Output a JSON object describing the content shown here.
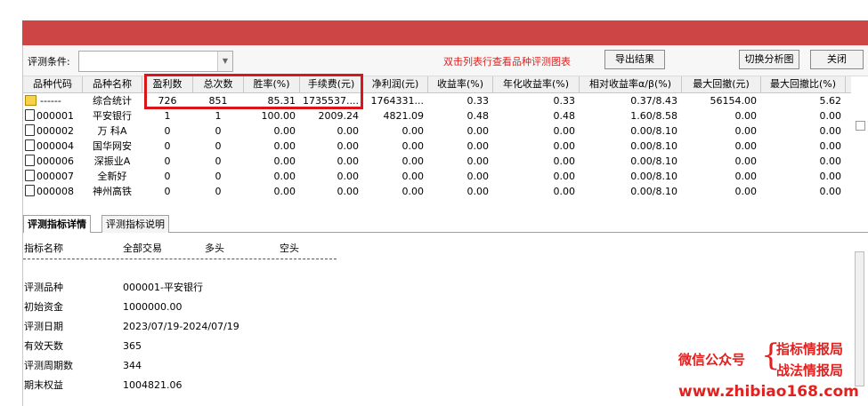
{
  "toolbar": {
    "condition_label": "评测条件:",
    "condition_value": "",
    "hint": "双击列表行查看品种评测图表",
    "export_label": "导出结果",
    "switch_label": "切换分析图",
    "close_label": "关闭"
  },
  "table": {
    "columns": [
      "品种代码",
      "品种名称",
      "盈利数",
      "总次数",
      "胜率(%)",
      "手续费(元)",
      "净利润(元)",
      "收益率(%)",
      "年化收益率(%)",
      "相对收益率α/β(%)",
      "最大回撤(元)",
      "最大回撤比(%)"
    ],
    "rows": [
      {
        "code": "------",
        "name": "综合统计",
        "wins": "726",
        "total": "851",
        "winrate": "85.31",
        "fee": "1735537....",
        "profit": "1764331...",
        "ret": "0.33",
        "annual": "0.33",
        "rel": "0.37/8.43",
        "maxdd": "56154.00",
        "maxddpct": "5.62"
      },
      {
        "code": "000001",
        "name": "平安银行",
        "wins": "1",
        "total": "1",
        "winrate": "100.00",
        "fee": "2009.24",
        "profit": "4821.09",
        "ret": "0.48",
        "annual": "0.48",
        "rel": "1.60/8.58",
        "maxdd": "0.00",
        "maxddpct": "0.00"
      },
      {
        "code": "000002",
        "name": "万 科A",
        "wins": "0",
        "total": "0",
        "winrate": "0.00",
        "fee": "0.00",
        "profit": "0.00",
        "ret": "0.00",
        "annual": "0.00",
        "rel": "0.00/8.10",
        "maxdd": "0.00",
        "maxddpct": "0.00"
      },
      {
        "code": "000004",
        "name": "国华网安",
        "wins": "0",
        "total": "0",
        "winrate": "0.00",
        "fee": "0.00",
        "profit": "0.00",
        "ret": "0.00",
        "annual": "0.00",
        "rel": "0.00/8.10",
        "maxdd": "0.00",
        "maxddpct": "0.00"
      },
      {
        "code": "000006",
        "name": "深振业A",
        "wins": "0",
        "total": "0",
        "winrate": "0.00",
        "fee": "0.00",
        "profit": "0.00",
        "ret": "0.00",
        "annual": "0.00",
        "rel": "0.00/8.10",
        "maxdd": "0.00",
        "maxddpct": "0.00"
      },
      {
        "code": "000007",
        "name": "全新好",
        "wins": "0",
        "total": "0",
        "winrate": "0.00",
        "fee": "0.00",
        "profit": "0.00",
        "ret": "0.00",
        "annual": "0.00",
        "rel": "0.00/8.10",
        "maxdd": "0.00",
        "maxddpct": "0.00"
      },
      {
        "code": "000008",
        "name": "神州高铁",
        "wins": "0",
        "total": "0",
        "winrate": "0.00",
        "fee": "0.00",
        "profit": "0.00",
        "ret": "0.00",
        "annual": "0.00",
        "rel": "0.00/8.10",
        "maxdd": "0.00",
        "maxddpct": "0.00"
      }
    ]
  },
  "tabs": [
    "评测指标详情",
    "评测指标说明"
  ],
  "detail": {
    "header": [
      "指标名称",
      "全部交易",
      "多头",
      "空头"
    ],
    "items": [
      {
        "key": "评测品种",
        "value": "000001-平安银行"
      },
      {
        "key": "初始资金",
        "value": "1000000.00"
      },
      {
        "key": "评测日期",
        "value": "2023/07/19-2024/07/19"
      },
      {
        "key": "有效天数",
        "value": "365"
      },
      {
        "key": "评测周期数",
        "value": "344"
      },
      {
        "key": "期末权益",
        "value": "1004821.06"
      }
    ]
  },
  "watermark": {
    "wechat": "微信公众号",
    "line1": "指标情报局",
    "line2": "战法情报局",
    "url": "www.zhibiao168.com"
  },
  "colors": {
    "title_bar": "#cd4544",
    "accent_red": "#e0211f",
    "highlight_box": "#d9161c"
  }
}
